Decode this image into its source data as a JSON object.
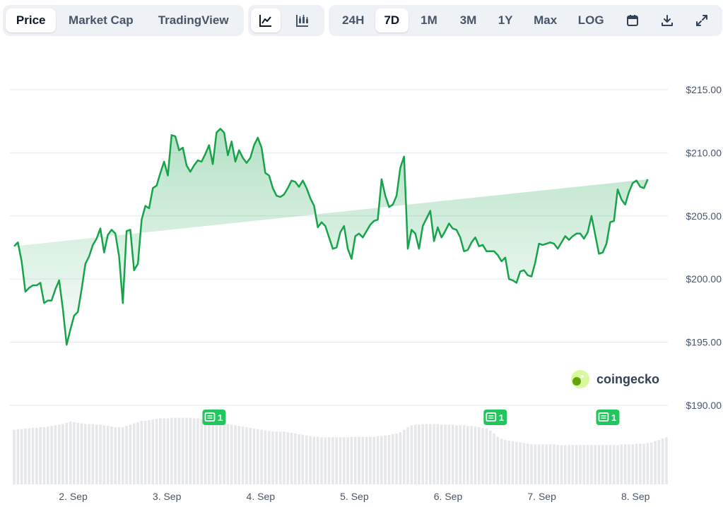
{
  "toolbar": {
    "view_tabs": [
      "Price",
      "Market Cap",
      "TradingView"
    ],
    "active_view": "Price",
    "chart_type_icons": [
      "line-chart-icon",
      "candlestick-chart-icon"
    ],
    "active_chart_type": "line-chart-icon",
    "ranges": [
      "24H",
      "7D",
      "1M",
      "3M",
      "1Y",
      "Max",
      "LOG"
    ],
    "active_range": "7D",
    "action_icons": [
      "calendar-icon",
      "download-icon",
      "expand-icon"
    ]
  },
  "watermark": "coingecko",
  "colors": {
    "line": "#16a34a",
    "fill": "#16a34a",
    "volume": "#e5e7eb",
    "news": "#22c55e"
  },
  "news_markers": [
    {
      "day": 3.5,
      "count": "1"
    },
    {
      "day": 6.5,
      "count": "1"
    },
    {
      "day": 7.7,
      "count": "1"
    }
  ],
  "chart_data": {
    "type": "area",
    "title": "",
    "xlabel": "",
    "ylabel": "",
    "y_ticks": [
      "$190.00",
      "$195.00",
      "$200.00",
      "$205.00",
      "$210.00",
      "$215.00"
    ],
    "x_ticks": [
      "2. Sep",
      "3. Sep",
      "4. Sep",
      "5. Sep",
      "6. Sep",
      "7. Sep",
      "8. Sep"
    ],
    "ylim": [
      190,
      215.5
    ],
    "xlim": [
      1.37,
      8.33
    ],
    "grid": true,
    "x": [
      1.37,
      1.41,
      1.45,
      1.49,
      1.53,
      1.57,
      1.61,
      1.65,
      1.69,
      1.73,
      1.77,
      1.81,
      1.85,
      1.89,
      1.93,
      1.97,
      2.01,
      2.05,
      2.09,
      2.13,
      2.17,
      2.21,
      2.25,
      2.29,
      2.33,
      2.37,
      2.41,
      2.45,
      2.49,
      2.53,
      2.57,
      2.61,
      2.65,
      2.69,
      2.73,
      2.77,
      2.81,
      2.85,
      2.89,
      2.93,
      2.97,
      3.01,
      3.05,
      3.09,
      3.13,
      3.17,
      3.21,
      3.25,
      3.29,
      3.33,
      3.37,
      3.41,
      3.45,
      3.49,
      3.53,
      3.57,
      3.61,
      3.65,
      3.69,
      3.73,
      3.77,
      3.81,
      3.85,
      3.89,
      3.93,
      3.97,
      4.01,
      4.05,
      4.09,
      4.13,
      4.17,
      4.21,
      4.25,
      4.29,
      4.33,
      4.37,
      4.41,
      4.45,
      4.49,
      4.53,
      4.57,
      4.61,
      4.65,
      4.69,
      4.73,
      4.77,
      4.81,
      4.85,
      4.89,
      4.93,
      4.97,
      5.01,
      5.05,
      5.09,
      5.13,
      5.17,
      5.21,
      5.25,
      5.29,
      5.33,
      5.37,
      5.41,
      5.45,
      5.49,
      5.53,
      5.57,
      5.61,
      5.65,
      5.69,
      5.73,
      5.77,
      5.81,
      5.85,
      5.89,
      5.93,
      5.97,
      6.01,
      6.05,
      6.09,
      6.13,
      6.17,
      6.21,
      6.25,
      6.29,
      6.33,
      6.37,
      6.41,
      6.45,
      6.49,
      6.53,
      6.57,
      6.61,
      6.65,
      6.69,
      6.73,
      6.77,
      6.81,
      6.85,
      6.89,
      6.93,
      6.97,
      7.01,
      7.05,
      7.09,
      7.13,
      7.17,
      7.21,
      7.25,
      7.29,
      7.33,
      7.37,
      7.41,
      7.45,
      7.49,
      7.53,
      7.57,
      7.61,
      7.65,
      7.69,
      7.73,
      7.77,
      7.81,
      7.85,
      7.89,
      7.93,
      7.97,
      8.01,
      8.05,
      8.09,
      8.13,
      8.17,
      8.21,
      8.25,
      8.29,
      8.33
    ],
    "series": [
      {
        "values": [
          202.6,
          202.9,
          201.4,
          199,
          199.3,
          199.5,
          199.5,
          199.7,
          198.1,
          198.3,
          198.3,
          199.2,
          199.9,
          197.6,
          194.8,
          196,
          197.1,
          197.4,
          199.2,
          201.2,
          201.8,
          202.7,
          203.2,
          204,
          202.1,
          203.5,
          203.9,
          203.6,
          201.8,
          198.1,
          203.8,
          203.9,
          200.7,
          201.2,
          204.7,
          205.8,
          205.6,
          207.2,
          207.4,
          208.4,
          209.3,
          208.2,
          211.4,
          211.3,
          210.2,
          210.4,
          209,
          208.5,
          209,
          209.4,
          209.3,
          209.9,
          210.6,
          209.1,
          211.6,
          211.9,
          211.6,
          209.8,
          210.9,
          209.3,
          210.2,
          209.6,
          209.2,
          209.6,
          210.6,
          211.2,
          210.4,
          208.4,
          208.2,
          207.2,
          206.6,
          206.5,
          206.7,
          207.2,
          207.8,
          207.7,
          207.3,
          207.8,
          207.2,
          206.4,
          205.8,
          204.1,
          204.5,
          204.2,
          203.3,
          202.4,
          202.5,
          203.7,
          204.2,
          202.4,
          201.6,
          203.4,
          203.6,
          203.3,
          203.8,
          204.3,
          204.6,
          204.7,
          207.9,
          206.6,
          205.7,
          205.9,
          206.6,
          208.8,
          209.7,
          202.4,
          203.9,
          203.6,
          202.4,
          204.2,
          204.8,
          205.4,
          203,
          204.1,
          203.3,
          203.8,
          204.4,
          204,
          203.9,
          203.3,
          202.2,
          202.3,
          202.9,
          203.3,
          202.6,
          202.7,
          202.2,
          202.2,
          202.2,
          201.9,
          201.4,
          201.7,
          200,
          199.9,
          199.7,
          200.6,
          200.7,
          200.3,
          200.2,
          201.3,
          202.8,
          202.7,
          202.8,
          202.9,
          202.8,
          202.4,
          202.9,
          203.4,
          203.1,
          203.4,
          203.6,
          203.6,
          203.2,
          203.7,
          205,
          203.5,
          202,
          202.1,
          202.8,
          204.5,
          204.6,
          207.1,
          206.3,
          205.9,
          206.9,
          207.6,
          207.8,
          207.3,
          207.2,
          207.9
        ]
      }
    ],
    "volume_relative": [
      0.86,
      0.87,
      0.87,
      0.88,
      0.88,
      0.89,
      0.89,
      0.9,
      0.9,
      0.91,
      0.92,
      0.93,
      0.94,
      0.95,
      0.97,
      0.99,
      0.98,
      0.97,
      0.96,
      0.95,
      0.95,
      0.95,
      0.94,
      0.94,
      0.93,
      0.92,
      0.91,
      0.9,
      0.9,
      0.9,
      0.92,
      0.94,
      0.96,
      0.98,
      1,
      1,
      1.01,
      1.02,
      1.03,
      1.04,
      1.04,
      1.04,
      1.05,
      1.05,
      1.05,
      1.05,
      1.05,
      1.05,
      1.04,
      1.04,
      1.03,
      1.02,
      1.01,
      1,
      0.99,
      0.97,
      0.96,
      0.95,
      0.94,
      0.93,
      0.92,
      0.91,
      0.9,
      0.89,
      0.88,
      0.87,
      0.86,
      0.85,
      0.84,
      0.83,
      0.83,
      0.83,
      0.83,
      0.82,
      0.81,
      0.8,
      0.79,
      0.78,
      0.77,
      0.76,
      0.75,
      0.75,
      0.74,
      0.74,
      0.74,
      0.74,
      0.74,
      0.74,
      0.74,
      0.74,
      0.75,
      0.75,
      0.75,
      0.75,
      0.75,
      0.75,
      0.75,
      0.76,
      0.76,
      0.77,
      0.78,
      0.79,
      0.8,
      0.82,
      0.86,
      0.9,
      0.93,
      0.94,
      0.94,
      0.95,
      0.95,
      0.95,
      0.95,
      0.95,
      0.94,
      0.94,
      0.94,
      0.94,
      0.93,
      0.93,
      0.93,
      0.92,
      0.92,
      0.91,
      0.9,
      0.89,
      0.88,
      0.85,
      0.8,
      0.75,
      0.72,
      0.7,
      0.69,
      0.68,
      0.67,
      0.66,
      0.65,
      0.64,
      0.63,
      0.63,
      0.63,
      0.63,
      0.63,
      0.63,
      0.63,
      0.62,
      0.62,
      0.62,
      0.62,
      0.62,
      0.62,
      0.62,
      0.62,
      0.62,
      0.62,
      0.62,
      0.62,
      0.62,
      0.62,
      0.62,
      0.62,
      0.62,
      0.63,
      0.63,
      0.63,
      0.63,
      0.64,
      0.64,
      0.64,
      0.65,
      0.66,
      0.68,
      0.7,
      0.72,
      0.74,
      0.76,
      0.78,
      0.8,
      0.8
    ]
  }
}
